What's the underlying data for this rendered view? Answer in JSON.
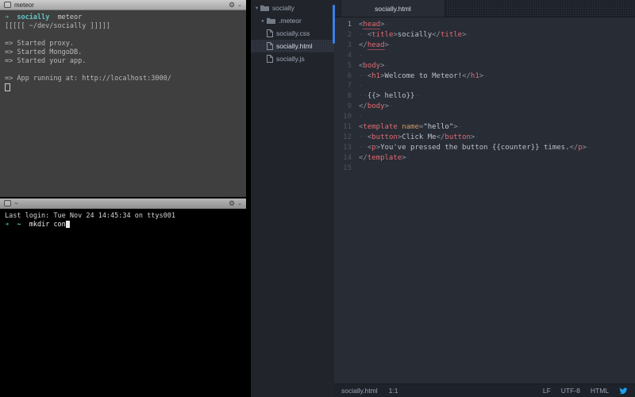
{
  "terminal1": {
    "title": "meteor",
    "lines": [
      {
        "tokens": [
          {
            "t": "➜",
            "c": "ar"
          },
          {
            "t": "  ",
            "c": "out"
          },
          {
            "t": "socially",
            "c": "dir"
          },
          {
            "t": "  meteor",
            "c": "cmd"
          }
        ]
      },
      {
        "tokens": [
          {
            "t": "[[[[[ ~/dev/socially ]]]]]",
            "c": "out"
          }
        ]
      },
      {
        "tokens": []
      },
      {
        "tokens": [
          {
            "t": "=> Started proxy.",
            "c": "out"
          }
        ]
      },
      {
        "tokens": [
          {
            "t": "=> Started MongoDB.",
            "c": "out"
          }
        ]
      },
      {
        "tokens": [
          {
            "t": "=> Started your app.",
            "c": "out"
          }
        ]
      },
      {
        "tokens": []
      },
      {
        "tokens": [
          {
            "t": "=> App running at: http://localhost:3000/",
            "c": "out"
          }
        ]
      },
      {
        "tokens": [
          {
            "t": "",
            "c": "cur"
          }
        ]
      }
    ]
  },
  "terminal2": {
    "title": "~",
    "lines": [
      {
        "tokens": [
          {
            "t": "Last login: Tue Nov 24 14:45:34 on ttys001",
            "c": "out"
          }
        ]
      },
      {
        "tokens": [
          {
            "t": "➜",
            "c": "ar"
          },
          {
            "t": "  ",
            "c": "out"
          },
          {
            "t": "~",
            "c": "dir"
          },
          {
            "t": "  mkdir con",
            "c": "cmd2"
          },
          {
            "t": "",
            "c": "curf"
          }
        ]
      }
    ]
  },
  "icons": {
    "gear": "⚙",
    "chevron": "⌄"
  },
  "tree": {
    "items": [
      {
        "type": "folder",
        "state": "expanded",
        "label": "socially",
        "depth": 0,
        "selected": false
      },
      {
        "type": "folder",
        "state": "collapsed",
        "label": ".meteor",
        "depth": 1,
        "selected": false
      },
      {
        "type": "file",
        "label": "socially.css",
        "depth": 1,
        "selected": false
      },
      {
        "type": "file",
        "label": "socially.html",
        "depth": 1,
        "selected": true
      },
      {
        "type": "file",
        "label": "socially.js",
        "depth": 1,
        "selected": false
      }
    ]
  },
  "editor": {
    "tab": "socially.html",
    "lines": [
      {
        "n": 1,
        "active": true,
        "tokens": [
          {
            "t": "<",
            "c": "p"
          },
          {
            "t": "head",
            "c": "tu"
          },
          {
            "t": ">",
            "c": "p"
          },
          {
            "t": "-",
            "c": "i"
          }
        ]
      },
      {
        "n": 2,
        "tokens": [
          {
            "t": "··",
            "c": "i"
          },
          {
            "t": "<",
            "c": "p"
          },
          {
            "t": "title",
            "c": "t"
          },
          {
            "t": ">",
            "c": "p"
          },
          {
            "t": "socially",
            "c": "x"
          },
          {
            "t": "</",
            "c": "p"
          },
          {
            "t": "title",
            "c": "t"
          },
          {
            "t": ">",
            "c": "p"
          },
          {
            "t": "-",
            "c": "i"
          }
        ]
      },
      {
        "n": 3,
        "tokens": [
          {
            "t": "</",
            "c": "p"
          },
          {
            "t": "head",
            "c": "tu"
          },
          {
            "t": ">",
            "c": "p"
          },
          {
            "t": "-",
            "c": "i"
          }
        ]
      },
      {
        "n": 4,
        "tokens": [
          {
            "t": "-",
            "c": "i"
          }
        ]
      },
      {
        "n": 5,
        "tokens": [
          {
            "t": "<",
            "c": "p"
          },
          {
            "t": "body",
            "c": "t"
          },
          {
            "t": ">",
            "c": "p"
          },
          {
            "t": "-",
            "c": "i"
          }
        ]
      },
      {
        "n": 6,
        "tokens": [
          {
            "t": "··",
            "c": "i"
          },
          {
            "t": "<",
            "c": "p"
          },
          {
            "t": "h1",
            "c": "t"
          },
          {
            "t": ">",
            "c": "p"
          },
          {
            "t": "Welcome to Meteor!",
            "c": "x"
          },
          {
            "t": "</",
            "c": "p"
          },
          {
            "t": "h1",
            "c": "t"
          },
          {
            "t": ">",
            "c": "p"
          },
          {
            "t": "-",
            "c": "i"
          }
        ]
      },
      {
        "n": 7,
        "tokens": [
          {
            "t": "-",
            "c": "i"
          }
        ]
      },
      {
        "n": 8,
        "tokens": [
          {
            "t": "··",
            "c": "i"
          },
          {
            "t": "{{> hello}}",
            "c": "x"
          },
          {
            "t": "-",
            "c": "i"
          }
        ]
      },
      {
        "n": 9,
        "tokens": [
          {
            "t": "</",
            "c": "p"
          },
          {
            "t": "body",
            "c": "t"
          },
          {
            "t": ">",
            "c": "p"
          },
          {
            "t": "-",
            "c": "i"
          }
        ]
      },
      {
        "n": 10,
        "tokens": [
          {
            "t": "-",
            "c": "i"
          }
        ]
      },
      {
        "n": 11,
        "tokens": [
          {
            "t": "<",
            "c": "p"
          },
          {
            "t": "template",
            "c": "t"
          },
          {
            "t": " ",
            "c": "x"
          },
          {
            "t": "name",
            "c": "a"
          },
          {
            "t": "=",
            "c": "p"
          },
          {
            "t": "\"hello\"",
            "c": "s"
          },
          {
            "t": ">",
            "c": "p"
          },
          {
            "t": "-",
            "c": "i"
          }
        ]
      },
      {
        "n": 12,
        "tokens": [
          {
            "t": "··",
            "c": "i"
          },
          {
            "t": "<",
            "c": "p"
          },
          {
            "t": "button",
            "c": "t"
          },
          {
            "t": ">",
            "c": "p"
          },
          {
            "t": "Click Me",
            "c": "x"
          },
          {
            "t": "</",
            "c": "p"
          },
          {
            "t": "button",
            "c": "t"
          },
          {
            "t": ">",
            "c": "p"
          },
          {
            "t": "-",
            "c": "i"
          }
        ]
      },
      {
        "n": 13,
        "tokens": [
          {
            "t": "··",
            "c": "i"
          },
          {
            "t": "<",
            "c": "p"
          },
          {
            "t": "p",
            "c": "t"
          },
          {
            "t": ">",
            "c": "p"
          },
          {
            "t": "You've pressed the button {{counter}} times.",
            "c": "x"
          },
          {
            "t": "</",
            "c": "p"
          },
          {
            "t": "p",
            "c": "t"
          },
          {
            "t": ">",
            "c": "p"
          },
          {
            "t": "-",
            "c": "i"
          }
        ]
      },
      {
        "n": 14,
        "tokens": [
          {
            "t": "</",
            "c": "p"
          },
          {
            "t": "template",
            "c": "t"
          },
          {
            "t": ">",
            "c": "p"
          },
          {
            "t": "-",
            "c": "i"
          }
        ]
      },
      {
        "n": 15,
        "tokens": []
      }
    ]
  },
  "statusbar": {
    "file": "socially.html",
    "position": "1:1",
    "line_ending": "LF",
    "encoding": "UTF-8",
    "grammar": "HTML"
  },
  "colors": {
    "accent_blue": "#3d7de8",
    "tag_red": "#e06c75",
    "attr_orange": "#d19a66",
    "prompt_teal": "#45b999",
    "prompt_cyan": "#63c5c5",
    "bird_blue": "#1da1f2",
    "editor_bg": "#282c34",
    "panel_bg": "#21252b",
    "terminal1_bg": "#3f3f3f",
    "terminal2_bg": "#000000"
  }
}
